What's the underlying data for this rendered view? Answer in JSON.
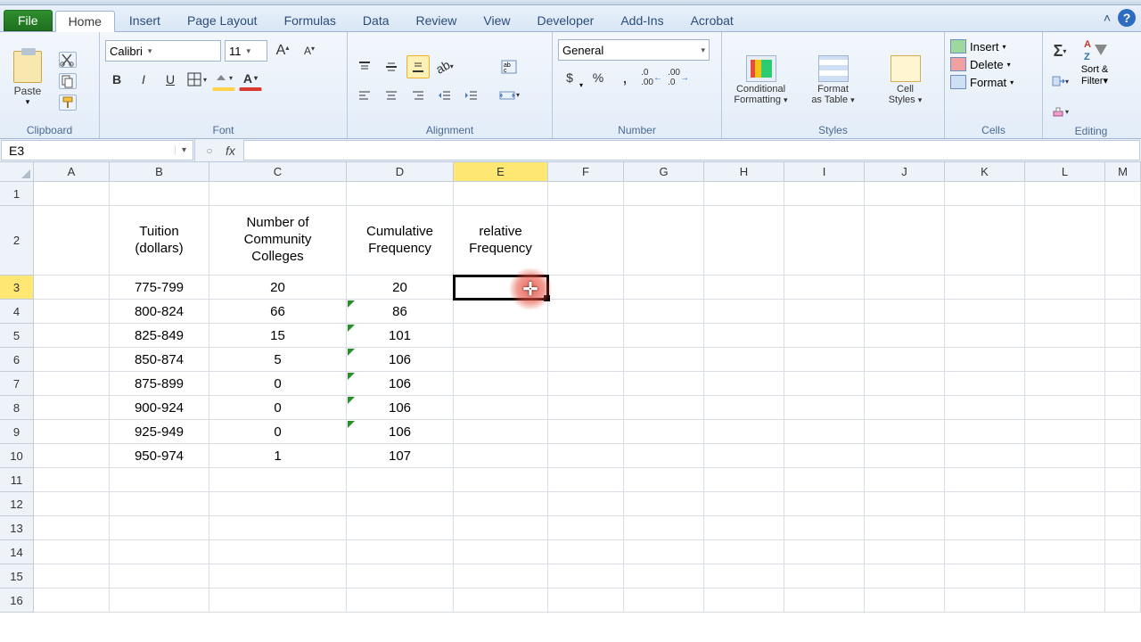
{
  "tabs": {
    "file": "File",
    "items": [
      "Home",
      "Insert",
      "Page Layout",
      "Formulas",
      "Data",
      "Review",
      "View",
      "Developer",
      "Add-Ins",
      "Acrobat"
    ],
    "active": "Home"
  },
  "ribbon": {
    "clipboard": {
      "label": "Clipboard",
      "paste": "Paste"
    },
    "font": {
      "label": "Font",
      "name": "Calibri",
      "size": "11",
      "bold": "B",
      "italic": "I",
      "underline": "U",
      "grow": "A",
      "shrink": "A"
    },
    "alignment": {
      "label": "Alignment"
    },
    "number": {
      "label": "Number",
      "format": "General",
      "currency": "$",
      "percent": "%",
      "comma": ",",
      "inc": ".0",
      "dec": ".00"
    },
    "styles": {
      "label": "Styles",
      "cond1": "Conditional",
      "cond2": "Formatting",
      "fmt1": "Format",
      "fmt2": "as Table",
      "cell1": "Cell",
      "cell2": "Styles"
    },
    "cells": {
      "label": "Cells",
      "insert": "Insert",
      "delete": "Delete",
      "format": "Format"
    },
    "editing": {
      "label": "Editing",
      "sigma": "Σ",
      "sort1": "Sort &",
      "sort2": "Filter"
    }
  },
  "formula_bar": {
    "namebox": "E3",
    "fx": "fx",
    "value": ""
  },
  "columns": [
    "A",
    "B",
    "C",
    "D",
    "E",
    "F",
    "G",
    "H",
    "I",
    "J",
    "K",
    "L",
    "M"
  ],
  "headers": {
    "B": "Tuition (dollars)",
    "C": "Number of Community Colleges",
    "D": "Cumulative Frequency",
    "E": "relative Frequency"
  },
  "rows": [
    {
      "n": "1"
    },
    {
      "n": "2"
    },
    {
      "n": "3",
      "B": "775-799",
      "C": "20",
      "D": "20"
    },
    {
      "n": "4",
      "B": "800-824",
      "C": "66",
      "D": "86",
      "err": true
    },
    {
      "n": "5",
      "B": "825-849",
      "C": "15",
      "D": "101",
      "err": true
    },
    {
      "n": "6",
      "B": "850-874",
      "C": "5",
      "D": "106",
      "err": true
    },
    {
      "n": "7",
      "B": "875-899",
      "C": "0",
      "D": "106",
      "err": true
    },
    {
      "n": "8",
      "B": "900-924",
      "C": "0",
      "D": "106",
      "err": true
    },
    {
      "n": "9",
      "B": "925-949",
      "C": "0",
      "D": "106",
      "err": true
    },
    {
      "n": "10",
      "B": "950-974",
      "C": "1",
      "D": "107"
    },
    {
      "n": "11"
    },
    {
      "n": "12"
    },
    {
      "n": "13"
    },
    {
      "n": "14"
    },
    {
      "n": "15"
    },
    {
      "n": "16"
    }
  ],
  "selection": {
    "col": "E",
    "row": "3"
  }
}
